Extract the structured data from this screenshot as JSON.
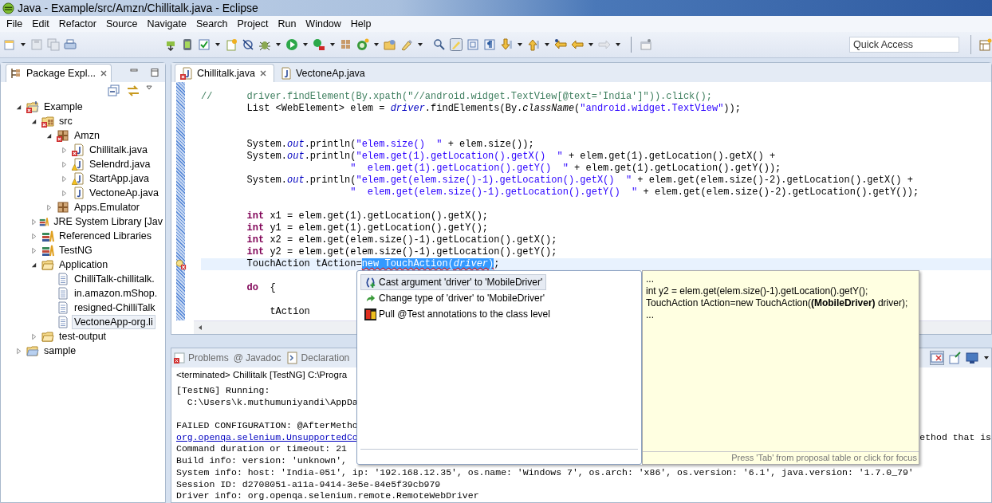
{
  "window": {
    "title": "Java - Example/src/Amzn/Chillitalk.java - Eclipse"
  },
  "menu": [
    "File",
    "Edit",
    "Refactor",
    "Source",
    "Navigate",
    "Search",
    "Project",
    "Run",
    "Window",
    "Help"
  ],
  "quick_access": {
    "placeholder": "Quick Access"
  },
  "package_explorer": {
    "title": "Package Expl...",
    "tree": [
      {
        "label": "Example",
        "kind": "project",
        "error": true,
        "warning": false,
        "expanded": true,
        "selected": false,
        "children": [
          {
            "label": "src",
            "kind": "source-folder",
            "error": true,
            "warning": false,
            "expanded": true,
            "selected": false,
            "children": [
              {
                "label": "Amzn",
                "kind": "package",
                "error": true,
                "warning": false,
                "expanded": true,
                "selected": false,
                "children": [
                  {
                    "label": "Chillitalk.java",
                    "kind": "java",
                    "error": true,
                    "warning": false,
                    "expanded": false,
                    "selected": false
                  },
                  {
                    "label": "Selendrd.java",
                    "kind": "java",
                    "error": false,
                    "warning": true,
                    "expanded": false,
                    "selected": false
                  },
                  {
                    "label": "StartApp.java",
                    "kind": "java",
                    "error": false,
                    "warning": true,
                    "expanded": false,
                    "selected": false
                  },
                  {
                    "label": "VectoneAp.java",
                    "kind": "java",
                    "error": false,
                    "warning": false,
                    "expanded": false,
                    "selected": false
                  }
                ]
              },
              {
                "label": "Apps.Emulator",
                "kind": "package",
                "error": false,
                "warning": false,
                "expanded": false,
                "selected": false
              }
            ]
          },
          {
            "label": "JRE System Library [Jav",
            "kind": "library",
            "error": false,
            "warning": false,
            "expanded": false,
            "selected": false
          },
          {
            "label": "Referenced Libraries",
            "kind": "library",
            "error": false,
            "warning": false,
            "expanded": false,
            "selected": false
          },
          {
            "label": "TestNG",
            "kind": "library",
            "error": false,
            "warning": false,
            "expanded": false,
            "selected": false
          },
          {
            "label": "Application",
            "kind": "folder",
            "error": false,
            "warning": false,
            "expanded": true,
            "selected": false,
            "children": [
              {
                "label": "ChilliTalk-chillitalk.",
                "kind": "file",
                "error": false,
                "warning": false,
                "selected": false
              },
              {
                "label": "in.amazon.mShop.",
                "kind": "file",
                "error": false,
                "warning": false,
                "selected": false
              },
              {
                "label": "resigned-ChilliTalk",
                "kind": "file",
                "error": false,
                "warning": false,
                "selected": false
              },
              {
                "label": "VectoneApp-org.li",
                "kind": "file",
                "error": false,
                "warning": false,
                "selected": true
              }
            ]
          },
          {
            "label": "test-output",
            "kind": "folder",
            "error": false,
            "warning": false,
            "expanded": false,
            "selected": false
          }
        ]
      },
      {
        "label": "sample",
        "kind": "project-folder",
        "error": false,
        "warning": false,
        "expanded": false,
        "selected": false
      }
    ]
  },
  "editor": {
    "tabs": [
      {
        "label": "Chillitalk.java",
        "selected": true,
        "error": true
      },
      {
        "label": "VectoneAp.java",
        "selected": false,
        "error": false
      }
    ],
    "lines": [
      {
        "current": false,
        "tokens": [
          {
            "text": "//      driver.findElement(By.xpath(\"//android.widget.TextView[@text='India']\")).click();",
            "kind": "comment"
          }
        ]
      },
      {
        "current": false,
        "tokens": [
          {
            "text": "        List <WebElement> elem = ",
            "kind": "plain"
          },
          {
            "text": "driver",
            "kind": "field"
          },
          {
            "text": ".findElements(By.",
            "kind": "plain"
          },
          {
            "text": "className",
            "kind": "method"
          },
          {
            "text": "(",
            "kind": "plain"
          },
          {
            "text": "\"android.widget.TextView\"",
            "kind": "string"
          },
          {
            "text": "));",
            "kind": "plain"
          }
        ]
      },
      {
        "current": false
      },
      {
        "current": false
      },
      {
        "current": false,
        "tokens": [
          {
            "text": "        System.",
            "kind": "plain"
          },
          {
            "text": "out",
            "kind": "field"
          },
          {
            "text": ".println(",
            "kind": "plain"
          },
          {
            "text": "\"elem.size()  \"",
            "kind": "string"
          },
          {
            "text": " + elem.size());",
            "kind": "plain"
          }
        ]
      },
      {
        "current": false,
        "tokens": [
          {
            "text": "        System.",
            "kind": "plain"
          },
          {
            "text": "out",
            "kind": "field"
          },
          {
            "text": ".println(",
            "kind": "plain"
          },
          {
            "text": "\"elem.get(1).getLocation().getX()  \"",
            "kind": "string"
          },
          {
            "text": " + elem.get(1).getLocation().getX() +",
            "kind": "plain"
          }
        ]
      },
      {
        "current": false,
        "tokens": [
          {
            "text": "                          \"  elem.get(1).getLocation().getY()  \"",
            "kind": "string"
          },
          {
            "text": " + elem.get(1).getLocation().getY());",
            "kind": "plain"
          }
        ]
      },
      {
        "current": false,
        "tokens": [
          {
            "text": "        System.",
            "kind": "plain"
          },
          {
            "text": "out",
            "kind": "field"
          },
          {
            "text": ".println(",
            "kind": "plain"
          },
          {
            "text": "\"elem.get(elem.size()-1).getLocation().getX()  \"",
            "kind": "string"
          },
          {
            "text": " + elem.get(elem.size()-2).getLocation().getX() +",
            "kind": "plain"
          }
        ]
      },
      {
        "current": false,
        "tokens": [
          {
            "text": "                          \"  elem.get(elem.size()-1).getLocation().getY()  \"",
            "kind": "string"
          },
          {
            "text": " + elem.get(elem.size()-2).getLocation().getY());",
            "kind": "plain"
          }
        ]
      },
      {
        "current": false
      },
      {
        "current": false,
        "tokens": [
          {
            "text": "        int",
            "kind": "keyword"
          },
          {
            "text": " x1 = elem.get(1).getLocation().getX();",
            "kind": "plain"
          }
        ]
      },
      {
        "current": false,
        "tokens": [
          {
            "text": "        int",
            "kind": "keyword"
          },
          {
            "text": " y1 = elem.get(1).getLocation().getY();",
            "kind": "plain"
          }
        ]
      },
      {
        "current": false,
        "tokens": [
          {
            "text": "        int",
            "kind": "keyword"
          },
          {
            "text": " x2 = elem.get(elem.size()-1).getLocation().getX();",
            "kind": "plain"
          }
        ]
      },
      {
        "current": false,
        "tokens": [
          {
            "text": "        int",
            "kind": "keyword"
          },
          {
            "text": " y2 = elem.get(elem.size()-1).getLocation().getY();",
            "kind": "plain"
          }
        ]
      },
      {
        "current": true,
        "error": true,
        "tokens": [
          {
            "text": "        TouchAction tAction=",
            "kind": "plain"
          },
          {
            "text": "new TouchAction(",
            "kind": "selection"
          },
          {
            "text": "driver",
            "kind": "selection-field"
          },
          {
            "text": ")",
            "kind": "selection"
          },
          {
            "text": ";",
            "kind": "plain"
          }
        ]
      },
      {
        "current": false
      },
      {
        "current": false,
        "tokens": [
          {
            "text": "        do",
            "kind": "keyword"
          },
          {
            "text": "  {",
            "kind": "plain"
          }
        ]
      },
      {
        "current": false
      },
      {
        "current": false,
        "tokens": [
          {
            "text": "            tAction",
            "kind": "plain"
          }
        ]
      }
    ]
  },
  "quick_fix": {
    "proposals": [
      {
        "label": "Cast argument 'driver' to 'MobileDriver'",
        "kind": "cast",
        "selected": true
      },
      {
        "label": "Change type of 'driver' to 'MobileDriver'",
        "kind": "change",
        "selected": false
      },
      {
        "label": "Pull @Test annotations to the class level",
        "kind": "testng",
        "selected": false
      }
    ],
    "preview": [
      "...",
      "int y2 = elem.get(elem.size()-1).getLocation().getY();",
      "TouchAction tAction=new TouchAction(**(MobileDriver)** driver);",
      "..."
    ],
    "hint": "Press 'Tab' from proposal table or click for focus"
  },
  "console": {
    "tabs": [
      {
        "label": "Problems",
        "kind": "problems"
      },
      {
        "label": "Javadoc",
        "kind": "javadoc",
        "glyph": "@"
      },
      {
        "label": "Declaration",
        "kind": "declaration"
      }
    ],
    "header": "<terminated> Chillitalk [TestNG] C:\\Progra",
    "lines": [
      {
        "text": "[TestNG] Running:",
        "kind": "plain"
      },
      {
        "text": "  C:\\Users\\k.muthumuniyandi\\AppDa",
        "kind": "plain"
      },
      {
        "kind": "blank"
      },
      {
        "text": "FAILED CONFIGURATION: @AfterMetho",
        "kind": "plain"
      },
      {
        "text": "org.openqa.selenium.UnsupportedCo",
        "kind": "link",
        "right": "ethod that is"
      },
      {
        "text": "Command duration or timeout: 21",
        "kind": "plain"
      },
      {
        "text": "Build info: version: 'unknown',",
        "kind": "plain"
      },
      {
        "text": "System info: host: 'India-051', ip: '192.168.12.35', os.name: 'Windows 7', os.arch: 'x86', os.version: '6.1', java.version: '1.7.0_79'",
        "kind": "plain"
      },
      {
        "text": "Session ID: d2708051-a11a-9414-3e5e-84e5f39cb979",
        "kind": "plain"
      },
      {
        "text": "Driver info: org.openqa.selenium.remote.RemoteWebDriver",
        "kind": "plain"
      }
    ]
  }
}
